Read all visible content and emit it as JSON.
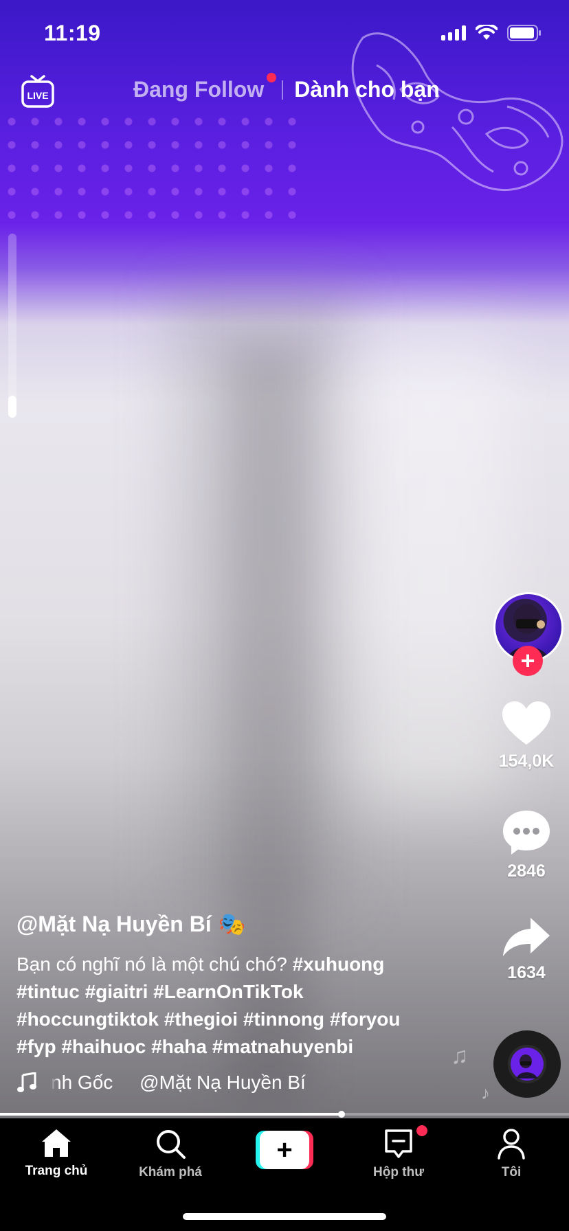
{
  "status_bar": {
    "time": "11:19"
  },
  "top_nav": {
    "live_label": "LIVE",
    "following_tab": "Đang Follow",
    "for_you_tab": "Dành cho bạn"
  },
  "creator": {
    "username": "@Mặt Nạ Huyền Bí",
    "username_emoji": "🎭"
  },
  "caption": {
    "text": "Bạn có nghĩ nó là một chú chó?",
    "hashtags": [
      "#xuhuong",
      "#tintuc",
      "#giaitri",
      "#LearnOnTikTok",
      "#hoccungtiktok",
      "#thegioi",
      "#tinnong",
      "#foryou",
      "#fyp",
      "#haihuoc",
      "#haha",
      "#matnahuyenbi"
    ]
  },
  "music": {
    "track": "nh Gốc     @Mặt Nạ Huyền Bí"
  },
  "actions": {
    "likes": "154,0K",
    "comments": "2846",
    "shares": "1634"
  },
  "video_progress_percent": 60,
  "bottom_nav": {
    "home": "Trang chủ",
    "discover": "Khám phá",
    "inbox": "Hộp thư",
    "me": "Tôi"
  },
  "colors": {
    "accent_red": "#fe2c55",
    "accent_cyan": "#25f4ee",
    "video_purple": "#5a1fe0"
  },
  "icons": [
    "live-icon",
    "heart-icon",
    "comment-icon",
    "share-icon",
    "music-note-icon",
    "home-icon",
    "search-icon",
    "plus-icon",
    "inbox-icon",
    "profile-icon"
  ]
}
